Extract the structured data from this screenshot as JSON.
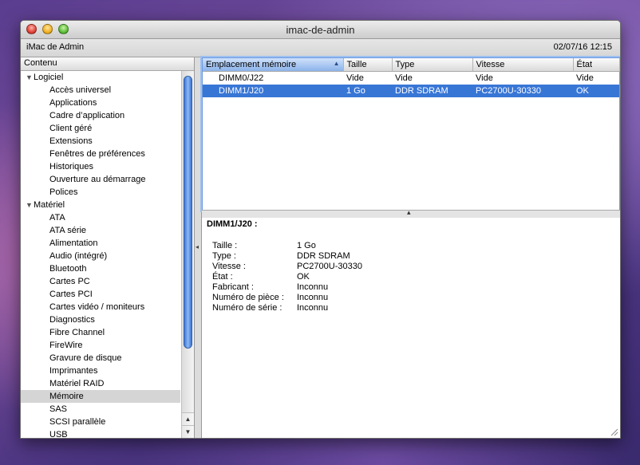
{
  "window": {
    "title": "imac-de-admin",
    "computer_name": "iMac de Admin",
    "datetime": "02/07/16 12:15"
  },
  "sidebar": {
    "header": "Contenu",
    "groups": [
      {
        "label": "Logiciel",
        "items": [
          "Accès universel",
          "Applications",
          "Cadre d’application",
          "Client géré",
          "Extensions",
          "Fenêtres de préférences",
          "Historiques",
          "Ouverture au démarrage",
          "Polices"
        ]
      },
      {
        "label": "Matériel",
        "items": [
          "ATA",
          "ATA série",
          "Alimentation",
          "Audio (intégré)",
          "Bluetooth",
          "Cartes PC",
          "Cartes PCI",
          "Cartes vidéo / moniteurs",
          "Diagnostics",
          "Fibre Channel",
          "FireWire",
          "Gravure de disque",
          "Imprimantes",
          "Matériel RAID",
          "Mémoire",
          "SAS",
          "SCSI parallèle",
          "USB"
        ]
      }
    ],
    "selected": "Mémoire"
  },
  "table": {
    "columns": [
      "Emplacement mémoire",
      "Taille",
      "Type",
      "Vitesse",
      "État"
    ],
    "rows": [
      {
        "slot": "DIMM0/J22",
        "size": "Vide",
        "type": "Vide",
        "speed": "Vide",
        "status": "Vide",
        "selected": false
      },
      {
        "slot": "DIMM1/J20",
        "size": "1 Go",
        "type": "DDR SDRAM",
        "speed": "PC2700U-30330",
        "status": "OK",
        "selected": true
      }
    ]
  },
  "detail": {
    "title": "DIMM1/J20 :",
    "fields": [
      {
        "key": "Taille :",
        "value": "1 Go"
      },
      {
        "key": "Type :",
        "value": "DDR SDRAM"
      },
      {
        "key": "Vitesse :",
        "value": "PC2700U-30330"
      },
      {
        "key": "État :",
        "value": "OK"
      },
      {
        "key": "Fabricant :",
        "value": "Inconnu"
      },
      {
        "key": "Numéro de pièce :",
        "value": "Inconnu"
      },
      {
        "key": "Numéro de série :",
        "value": "Inconnu"
      }
    ]
  },
  "icons": {
    "close": "close-button-icon",
    "minimize": "minimize-button-icon",
    "zoom": "zoom-button-icon",
    "sort": "sort-ascending-icon"
  },
  "colors": {
    "selection": "#3876d6",
    "accent": "#8cb3ea"
  }
}
